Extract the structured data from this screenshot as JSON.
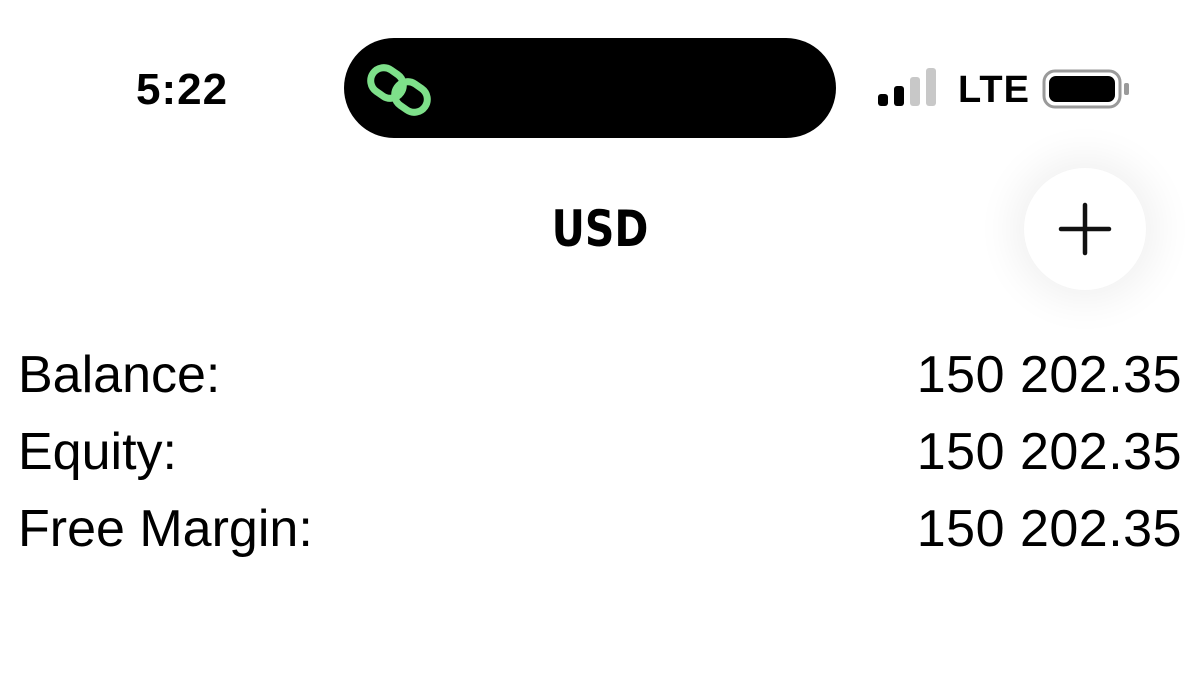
{
  "status_bar": {
    "time": "5:22",
    "network": "LTE",
    "signal_bars_active": 2,
    "signal_bars_total": 4,
    "battery_level": 1.0,
    "island_icon": "link-icon",
    "island_icon_color": "#7ee08a"
  },
  "header": {
    "title": "USD",
    "add_icon": "plus-icon"
  },
  "account": {
    "rows": [
      {
        "label": "Balance:",
        "value": "150 202.35"
      },
      {
        "label": "Equity:",
        "value": "150 202.35"
      },
      {
        "label": "Free Margin:",
        "value": "150 202.35"
      }
    ]
  }
}
